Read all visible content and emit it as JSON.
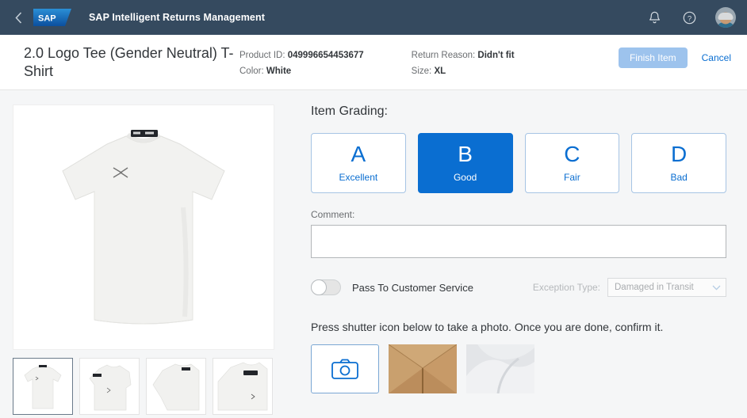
{
  "shell": {
    "back_icon": "chevron-left-icon",
    "logo_text": "SAP",
    "title": "SAP Intelligent Returns Management",
    "notifications_icon": "bell-icon",
    "help_icon": "question-mark-circle-icon",
    "avatar_icon": "user-avatar"
  },
  "object_header": {
    "title": "2.0 Logo Tee (Gender Neutral) T-Shirt",
    "fields": [
      {
        "label": "Product ID:",
        "value": "049996654453677"
      },
      {
        "label": "Color:",
        "value": "White"
      },
      {
        "label": "Return Reason:",
        "value": "Didn't fit"
      },
      {
        "label": "Size:",
        "value": "XL"
      }
    ],
    "finish_label": "Finish Item",
    "cancel_label": "Cancel"
  },
  "gallery": {
    "main_alt": "white t-shirt front view",
    "thumbnails": [
      {
        "alt": "t-shirt front",
        "selected": true
      },
      {
        "alt": "t-shirt angled left",
        "selected": false
      },
      {
        "alt": "t-shirt shoulder detail",
        "selected": false
      },
      {
        "alt": "t-shirt collar detail",
        "selected": false
      }
    ]
  },
  "grading": {
    "heading": "Item Grading:",
    "options": [
      {
        "letter": "A",
        "label": "Excellent",
        "selected": false
      },
      {
        "letter": "B",
        "label": "Good",
        "selected": true
      },
      {
        "letter": "C",
        "label": "Fair",
        "selected": false
      },
      {
        "letter": "D",
        "label": "Bad",
        "selected": false
      }
    ]
  },
  "comment": {
    "label": "Comment:",
    "value": "",
    "placeholder": ""
  },
  "pass_to_cs": {
    "label": "Pass To Customer Service",
    "state": "off"
  },
  "exception": {
    "label": "Exception Type:",
    "value": "Damaged in Transit",
    "chevron_icon": "chevron-down-icon",
    "disabled": true
  },
  "photo": {
    "hint": "Press shutter icon below to take a photo. Once you are done, confirm it.",
    "shutter_icon": "camera-icon",
    "captured": [
      {
        "alt": "cardboard box photo"
      },
      {
        "alt": "white fabric photo"
      }
    ]
  },
  "colors": {
    "shell_bg": "#354a5f",
    "accent_blue": "#0a6ed1",
    "content_bg": "#f5f6f7",
    "disabled_blue": "#9dc3ed"
  }
}
